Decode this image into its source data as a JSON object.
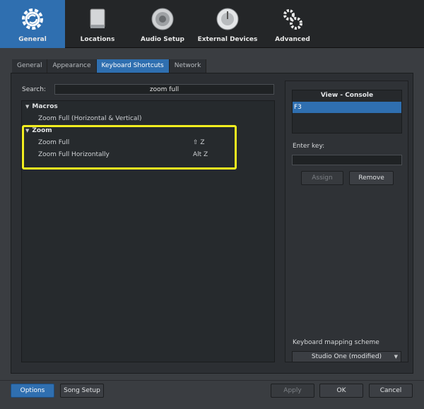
{
  "categories": [
    {
      "label": "General",
      "icon": "gear-icon",
      "active": true
    },
    {
      "label": "Locations",
      "icon": "drive-icon",
      "active": false
    },
    {
      "label": "Audio Setup",
      "icon": "speaker-icon",
      "active": false
    },
    {
      "label": "External Devices",
      "icon": "dial-icon",
      "active": false
    },
    {
      "label": "Advanced",
      "icon": "gears-icon",
      "active": false
    }
  ],
  "tabs": [
    {
      "label": "General",
      "active": false
    },
    {
      "label": "Appearance",
      "active": false
    },
    {
      "label": "Keyboard Shortcuts",
      "active": true
    },
    {
      "label": "Network",
      "active": false
    }
  ],
  "search": {
    "label": "Search:",
    "value": "zoom full"
  },
  "tree": {
    "groups": [
      {
        "name": "Macros",
        "items": [
          {
            "label": "Zoom Full (Horizontal & Vertical)",
            "shortcut": ""
          }
        ]
      },
      {
        "name": "Zoom",
        "items": [
          {
            "label": "Zoom Full",
            "shortcut": "⇧ Z"
          },
          {
            "label": "Zoom Full Horizontally",
            "shortcut": "Alt Z"
          }
        ]
      }
    ]
  },
  "right_panel": {
    "console_title": "View - Console",
    "console_selected": "F3",
    "enter_key_label": "Enter key:",
    "assign_label": "Assign",
    "remove_label": "Remove",
    "scheme_label": "Keyboard mapping scheme",
    "scheme_value": "Studio One (modified)"
  },
  "footer": {
    "options_label": "Options",
    "song_setup_label": "Song Setup",
    "apply_label": "Apply",
    "ok_label": "OK",
    "cancel_label": "Cancel"
  },
  "colors": {
    "accent": "#2f6fb0",
    "highlight": "#f2ee1f"
  }
}
